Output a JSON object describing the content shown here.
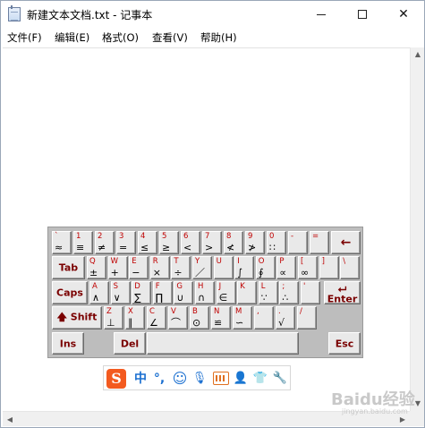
{
  "window": {
    "title": "新建文本文档.txt - 记事本",
    "minimize_label": "",
    "maximize_label": "",
    "close_label": "✕"
  },
  "menu": [
    {
      "label": "文件(F)"
    },
    {
      "label": "编辑(E)"
    },
    {
      "label": "格式(O)"
    },
    {
      "label": "查看(V)"
    },
    {
      "label": "帮助(H)"
    }
  ],
  "keyboard": {
    "row1": [
      {
        "top": "`",
        "bot": "≈"
      },
      {
        "top": "1",
        "bot": "≡"
      },
      {
        "top": "2",
        "bot": "≠"
      },
      {
        "top": "3",
        "bot": "="
      },
      {
        "top": "4",
        "bot": "≤"
      },
      {
        "top": "5",
        "bot": "≥"
      },
      {
        "top": "6",
        "bot": "<"
      },
      {
        "top": "7",
        "bot": ">"
      },
      {
        "top": "8",
        "bot": "≮"
      },
      {
        "top": "9",
        "bot": "≯"
      },
      {
        "top": "0",
        "bot": "∷"
      },
      {
        "top": "-",
        "bot": ""
      },
      {
        "top": "=",
        "bot": ""
      }
    ],
    "backspace_label": "←",
    "tab_label": "Tab",
    "row2": [
      {
        "top": "Q",
        "bot": "±"
      },
      {
        "top": "W",
        "bot": "+"
      },
      {
        "top": "E",
        "bot": "−"
      },
      {
        "top": "R",
        "bot": "×"
      },
      {
        "top": "T",
        "bot": "÷"
      },
      {
        "top": "Y",
        "bot": "／"
      },
      {
        "top": "U",
        "bot": ""
      },
      {
        "top": "I",
        "bot": "∫"
      },
      {
        "top": "O",
        "bot": "∮"
      },
      {
        "top": "P",
        "bot": "∝"
      },
      {
        "top": "[",
        "bot": "∞"
      },
      {
        "top": "]",
        "bot": ""
      },
      {
        "top": "\\",
        "bot": ""
      }
    ],
    "caps_label": "Caps",
    "row3": [
      {
        "top": "A",
        "bot": "∧"
      },
      {
        "top": "S",
        "bot": "∨"
      },
      {
        "top": "D",
        "bot": "∑"
      },
      {
        "top": "F",
        "bot": "∏"
      },
      {
        "top": "G",
        "bot": "∪"
      },
      {
        "top": "H",
        "bot": "∩"
      },
      {
        "top": "J",
        "bot": "∈"
      },
      {
        "top": "K",
        "bot": ""
      },
      {
        "top": "L",
        "bot": "∵"
      },
      {
        "top": ";",
        "bot": "∴"
      },
      {
        "top": "'",
        "bot": ""
      }
    ],
    "enter_arrow": "⮠",
    "enter_label": "Enter",
    "shift_arrow": "🡅",
    "shift_label": "Shift",
    "row4": [
      {
        "top": "Z",
        "bot": "⊥"
      },
      {
        "top": "X",
        "bot": "∥"
      },
      {
        "top": "C",
        "bot": "∠"
      },
      {
        "top": "V",
        "bot": "⌒"
      },
      {
        "top": "B",
        "bot": "⊙"
      },
      {
        "top": "N",
        "bot": "≌"
      },
      {
        "top": "M",
        "bot": "∽"
      },
      {
        "top": ",",
        "bot": ""
      },
      {
        "top": ".",
        "bot": "√"
      },
      {
        "top": "/",
        "bot": ""
      }
    ],
    "ins_label": "Ins",
    "del_label": "Del",
    "esc_label": "Esc"
  },
  "ime": {
    "logo": "S",
    "mode": "中",
    "punct": "°,",
    "emoji": "☺",
    "mic": "🎙",
    "user": "👤",
    "skin": "👕",
    "tools": "🔧"
  },
  "watermark": {
    "text": "Baidu经验",
    "sub": "jingyan.baidu.com"
  }
}
